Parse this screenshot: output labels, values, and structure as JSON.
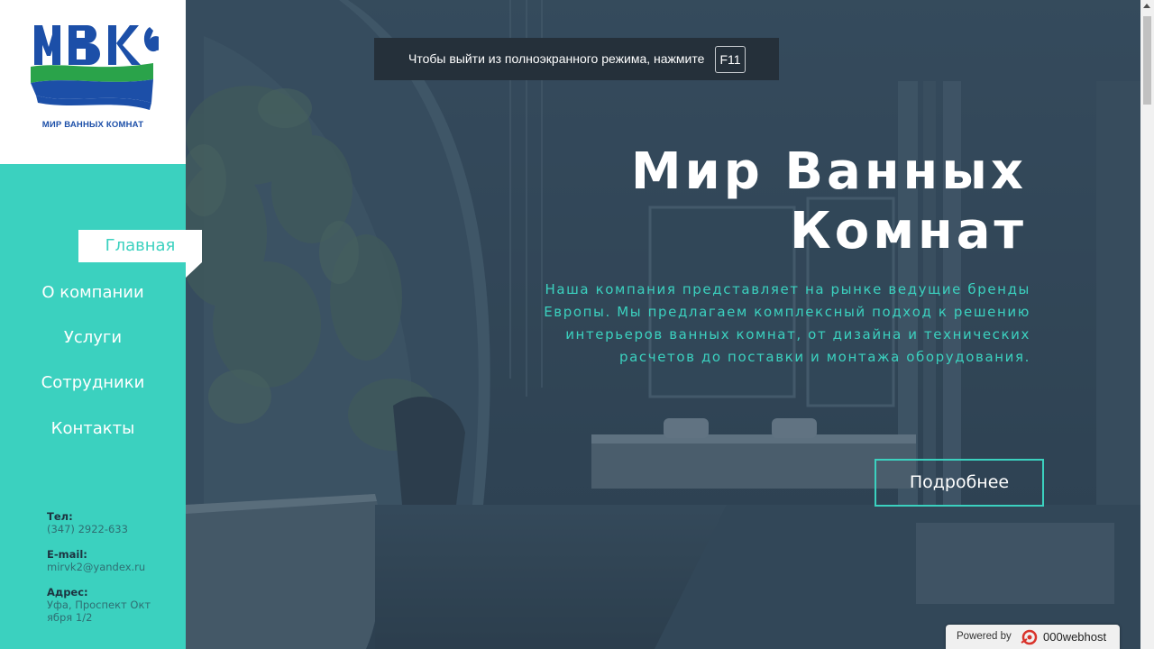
{
  "logo": {
    "mark": "MBK",
    "caption": "МИР ВАННЫХ КОМНАТ"
  },
  "nav": {
    "items": [
      {
        "label": "Главная",
        "active": true
      },
      {
        "label": "О компании"
      },
      {
        "label": "Услуги"
      },
      {
        "label": "Сотрудники"
      },
      {
        "label": "Контакты"
      }
    ]
  },
  "contacts": {
    "phone_label": "Тел:",
    "phone": "(347) 2922-633",
    "email_label": "E-mail:",
    "email": "mirvk2@yandex.ru",
    "address_label": "Адрес:",
    "address": "Уфа, Проспект Октября 1/2"
  },
  "fullscreen_notice": {
    "text": "Чтобы выйти из полноэкранного режима, нажмите",
    "key": "F11"
  },
  "hero": {
    "title_line1": "Мир Ванных",
    "title_line2": "Комнат",
    "description": "Наша компания представляет на рынке ведущие бренды Европы. Мы предлагаем комплексный подход к решению интерьеров ванных комнат, от дизайна и технических расчетов до поставки и монтажа оборудования.",
    "button_label": "Подробнее"
  },
  "powered": {
    "label": "Powered by",
    "brand": "000webhost",
    "icon": "webhost-logo-icon"
  },
  "colors": {
    "accent": "#3bd1bf",
    "overlay": "#2f4456",
    "logo_blue": "#1c4fa8",
    "logo_green": "#2aa34a"
  }
}
